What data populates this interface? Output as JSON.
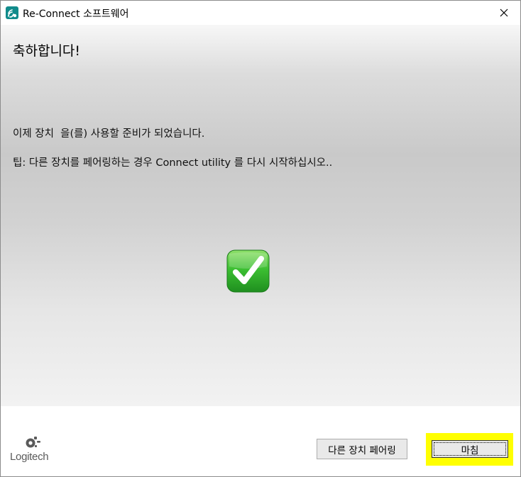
{
  "window": {
    "title": "Re-Connect 소프트웨어",
    "close_glyph": "✕"
  },
  "content": {
    "heading": "축하합니다!",
    "message": "이제 장치  을(를) 사용할 준비가 되었습니다.",
    "tip": "팁: 다른 장치를 페어링하는 경우 Connect utility 를 다시 시작하십시오..",
    "status_icon": "checkmark-icon"
  },
  "footer": {
    "logo_text": "Logitech",
    "pair_another_label": "다른 장치 페어링",
    "finish_label": "마침"
  },
  "colors": {
    "app_icon": "#118b8b",
    "check_green": "#2fb52f",
    "highlight": "#ffff00"
  }
}
